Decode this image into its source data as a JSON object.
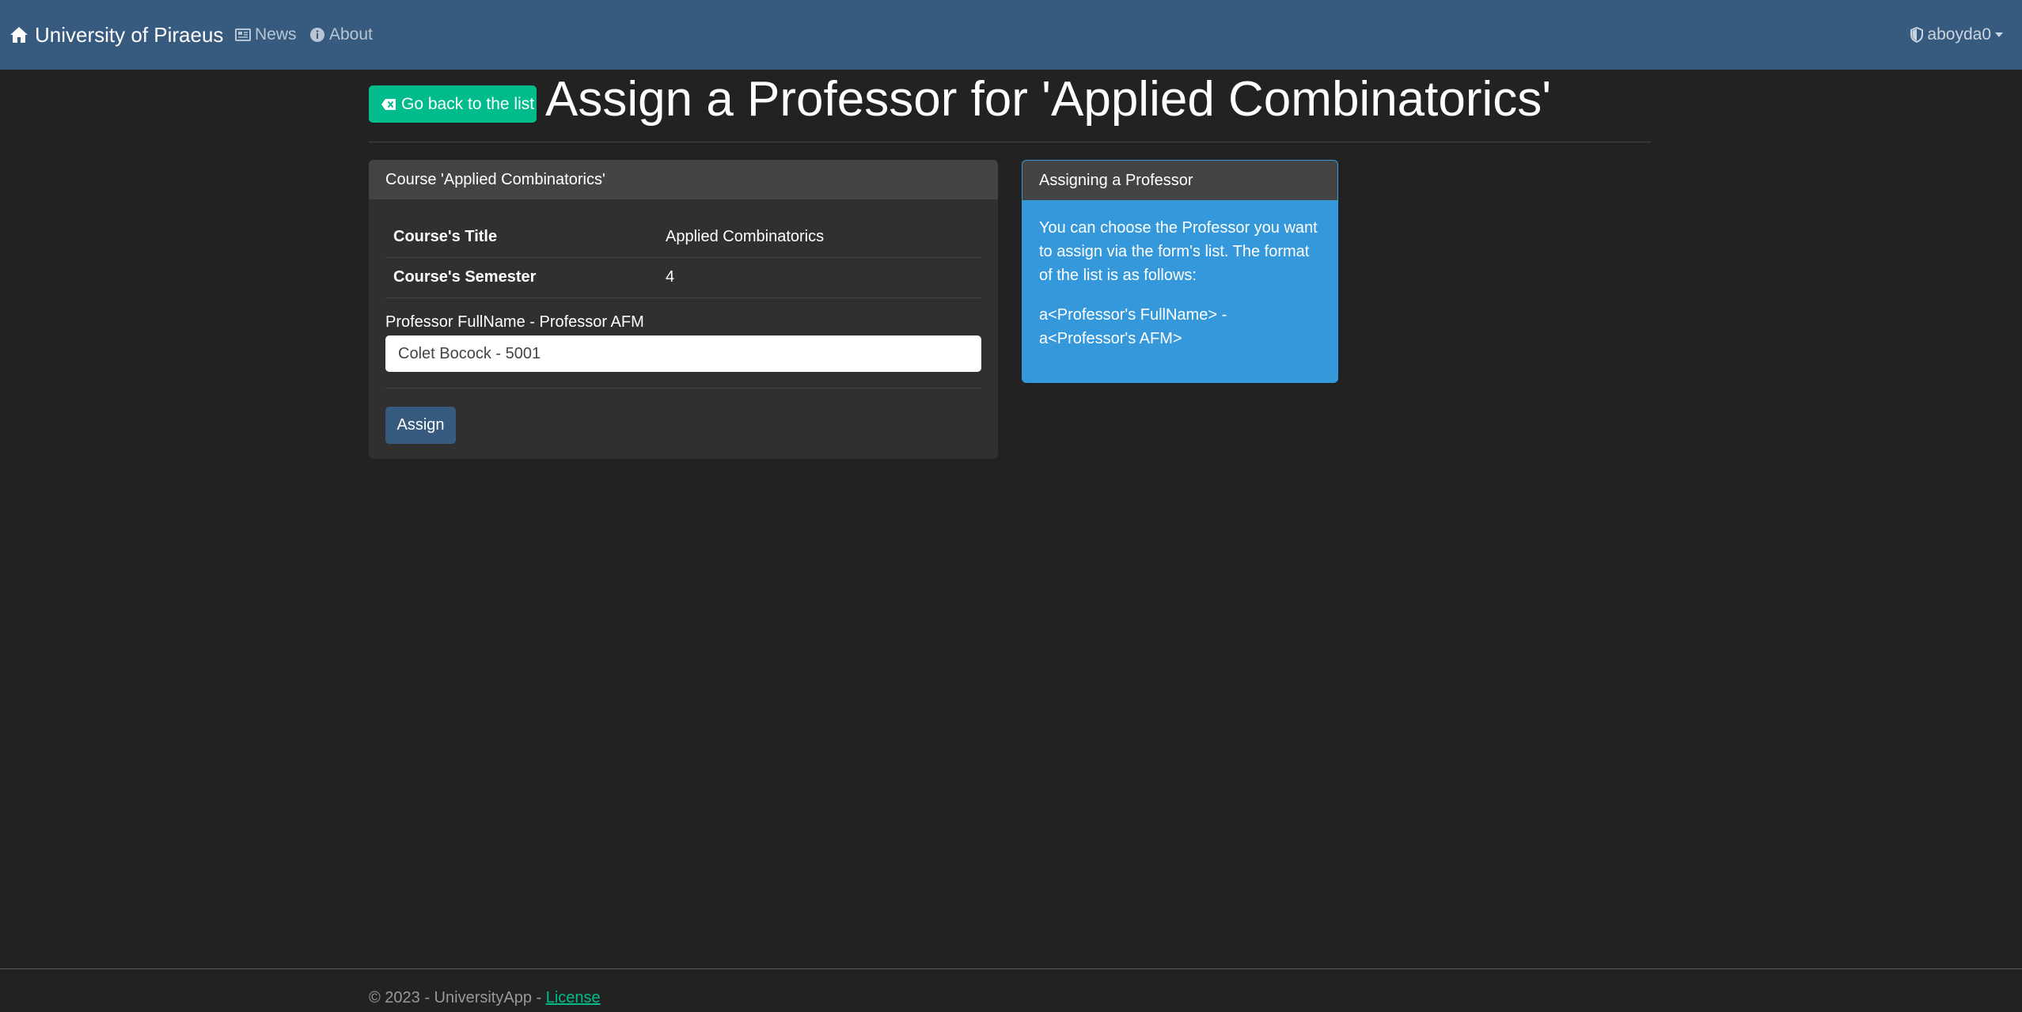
{
  "navbar": {
    "brand": "University of Piraeus",
    "news_label": "News",
    "about_label": "About",
    "user_label": "aboyda0",
    "brand_color": "#375a7f"
  },
  "header": {
    "back_label": "Go back to the list",
    "title": "Assign a Professor for 'Applied Combinatorics'"
  },
  "course_card": {
    "header": "Course 'Applied Combinatorics'",
    "rows": [
      {
        "label": "Course's Title",
        "value": "Applied Combinatorics"
      },
      {
        "label": "Course's Semester",
        "value": "4"
      }
    ],
    "field_label": "Professor FullName - Professor AFM",
    "selected_professor": "Colet Bocock - 5001",
    "assign_label": "Assign"
  },
  "info_card": {
    "header": "Assigning a Professor",
    "paragraph1": "You can choose the Professor you want to assign via the form's list. The format of the list is as follows:",
    "paragraph2": "a<Professor's FullName> - a<Professor's AFM>"
  },
  "footer": {
    "text": "© 2023 - UniversityApp - ",
    "license_label": "License"
  },
  "icons": {
    "brand": "home-icon",
    "news": "newspaper-icon",
    "about": "info-icon",
    "user": "shield-icon",
    "back": "backspace-icon"
  }
}
